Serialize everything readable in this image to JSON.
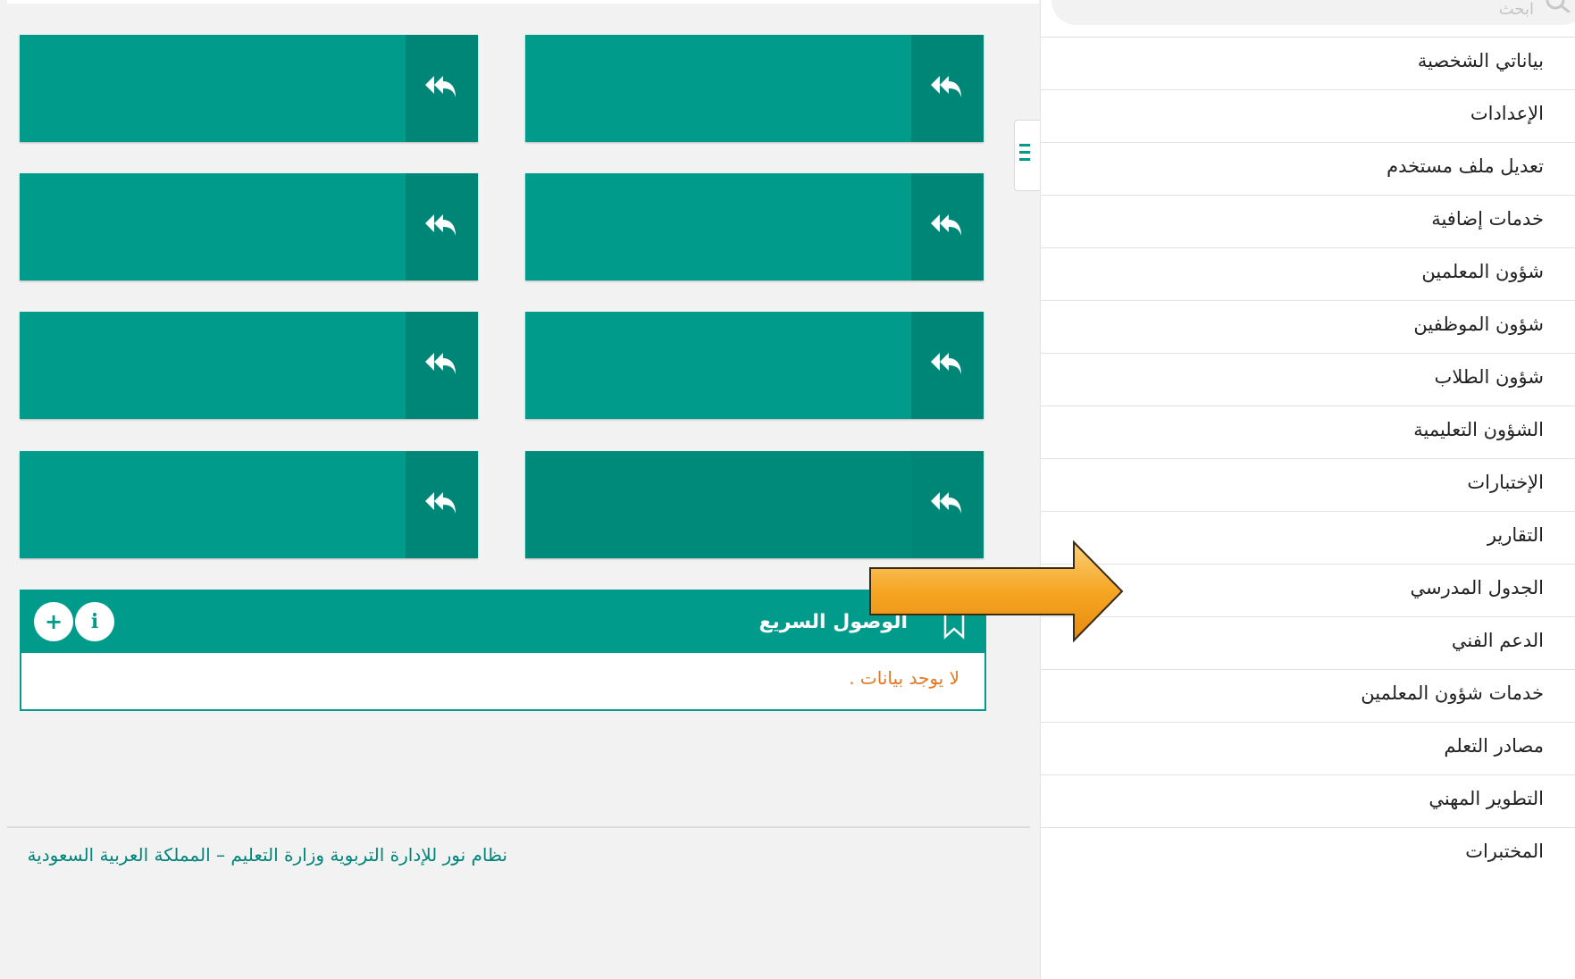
{
  "sidebar": {
    "search_placeholder": "ابحث",
    "items": [
      {
        "label": "بياناتي الشخصية"
      },
      {
        "label": "الإعدادات"
      },
      {
        "label": "تعديل ملف مستخدم"
      },
      {
        "label": "خدمات إضافية"
      },
      {
        "label": "شؤون المعلمين"
      },
      {
        "label": "شؤون الموظفين"
      },
      {
        "label": "شؤون الطلاب"
      },
      {
        "label": "الشؤون التعليمية"
      },
      {
        "label": "الإختبارات"
      },
      {
        "label": "التقارير"
      },
      {
        "label": "الجدول المدرسي"
      },
      {
        "label": "الدعم الفني"
      },
      {
        "label": "خدمات شؤون المعلمين"
      },
      {
        "label": "مصادر التعلم"
      },
      {
        "label": "التطوير المهني"
      },
      {
        "label": "المختبرات"
      }
    ]
  },
  "tiles": [
    {
      "icon": "reply-all-icon"
    },
    {
      "icon": "reply-all-icon"
    },
    {
      "icon": "reply-all-icon"
    },
    {
      "icon": "reply-all-icon"
    },
    {
      "icon": "reply-all-icon"
    },
    {
      "icon": "reply-all-icon"
    },
    {
      "icon": "reply-all-icon"
    },
    {
      "icon": "reply-all-icon"
    }
  ],
  "quick_access": {
    "title": "الوصول السريع",
    "empty_message": "لا يوجد بيانات .",
    "add_label": "+",
    "info_label": "i"
  },
  "footer": {
    "text": "نظام نور للإدارة التربوية وزارة التعليم – المملكة العربية السعودية"
  },
  "colors": {
    "primary": "#009b8a",
    "primary_dark": "#008676",
    "empty_text": "#e87722",
    "arrow": "#f5a623"
  }
}
